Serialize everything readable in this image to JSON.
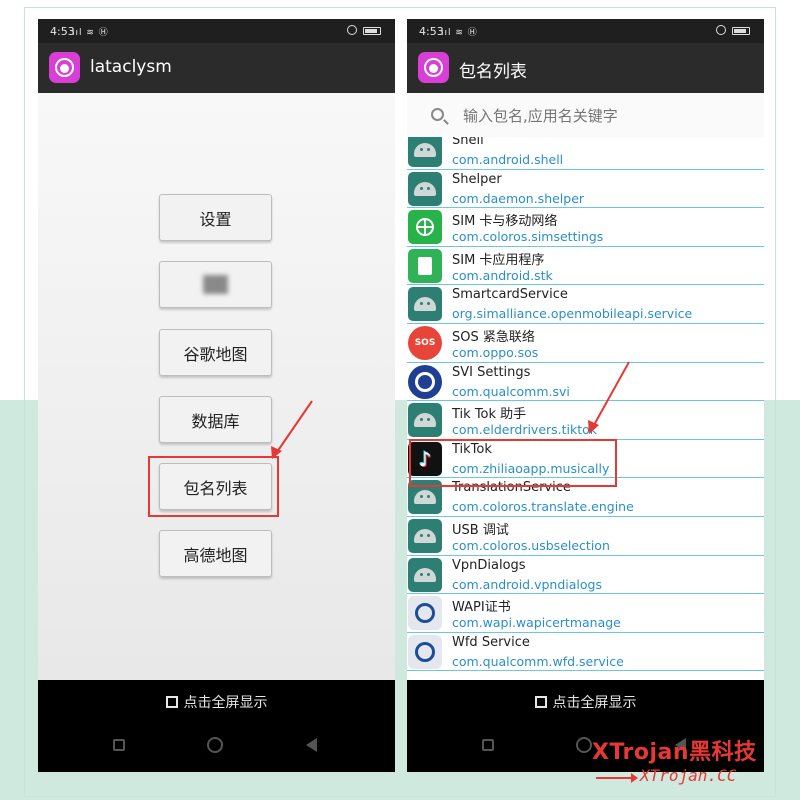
{
  "status_bar": {
    "time": "4:53",
    "signal": "ııl ≋ Ⓗ"
  },
  "left_screen": {
    "app_title": "lataclysm",
    "menu": [
      {
        "id": "settings",
        "label": "设置"
      },
      {
        "id": "hidden",
        "label": "██"
      },
      {
        "id": "google-map",
        "label": "谷歌地图"
      },
      {
        "id": "database",
        "label": "数据库"
      },
      {
        "id": "package-list",
        "label": "包名列表"
      },
      {
        "id": "amap",
        "label": "高德地图"
      }
    ],
    "fullscreen_label": "点击全屏显示"
  },
  "right_screen": {
    "app_title": "包名列表",
    "search_placeholder": "输入包名,应用名关键字",
    "apps": [
      {
        "name": "Shell",
        "package": "com.android.shell",
        "icon": "android"
      },
      {
        "name": "Shelper",
        "package": "com.daemon.shelper",
        "icon": "android"
      },
      {
        "name": "SIM 卡与移动网络",
        "package": "com.coloros.simsettings",
        "icon": "sim"
      },
      {
        "name": "SIM 卡应用程序",
        "package": "com.android.stk",
        "icon": "stk"
      },
      {
        "name": "SmartcardService",
        "package": "org.simalliance.openmobileapi.service",
        "icon": "android"
      },
      {
        "name": "SOS 紧急联络",
        "package": "com.oppo.sos",
        "icon": "sos"
      },
      {
        "name": "SVI Settings",
        "package": "com.qualcomm.svi",
        "icon": "qc"
      },
      {
        "name": "Tik Tok 助手",
        "package": "com.elderdrivers.tiktok",
        "icon": "android"
      },
      {
        "name": "TikTok",
        "package": "com.zhiliaoapp.musically",
        "icon": "tiktok"
      },
      {
        "name": "TranslationService",
        "package": "com.coloros.translate.engine",
        "icon": "android"
      },
      {
        "name": "USB 调试",
        "package": "com.coloros.usbselection",
        "icon": "android"
      },
      {
        "name": "VpnDialogs",
        "package": "com.android.vpndialogs",
        "icon": "android"
      },
      {
        "name": "WAPI证书",
        "package": "com.wapi.wapicertmanage",
        "icon": "wapi"
      },
      {
        "name": "Wfd Service",
        "package": "com.qualcomm.wfd.service",
        "icon": "wapi"
      }
    ],
    "fullscreen_label": "点击全屏显示"
  },
  "watermark": {
    "brand": "XTrojan黑科技",
    "url": "XTrojan.CC"
  },
  "colors": {
    "accent": "#e53935",
    "link": "#2a8fc9",
    "divider": "#6ac8e0",
    "logo": "#d93fd7"
  }
}
